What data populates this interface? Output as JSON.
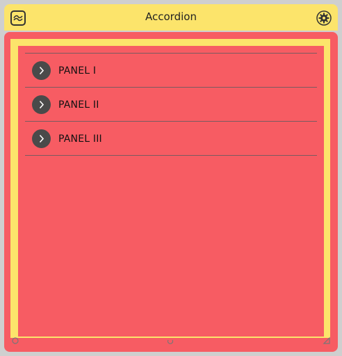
{
  "window": {
    "title": "Accordion"
  },
  "titlebar": {
    "app_icon": "app-icon",
    "settings_icon": "gear-icon"
  },
  "accordion": {
    "panels": [
      {
        "label": "PANEL I",
        "icon": "chevron-right-icon"
      },
      {
        "label": "PANEL II",
        "icon": "chevron-right-icon"
      },
      {
        "label": "PANEL III",
        "icon": "chevron-right-icon"
      }
    ]
  },
  "colors": {
    "titlebar": "#fce46b",
    "content": "#f75c63",
    "chevron_bg": "#4a4a4a"
  }
}
